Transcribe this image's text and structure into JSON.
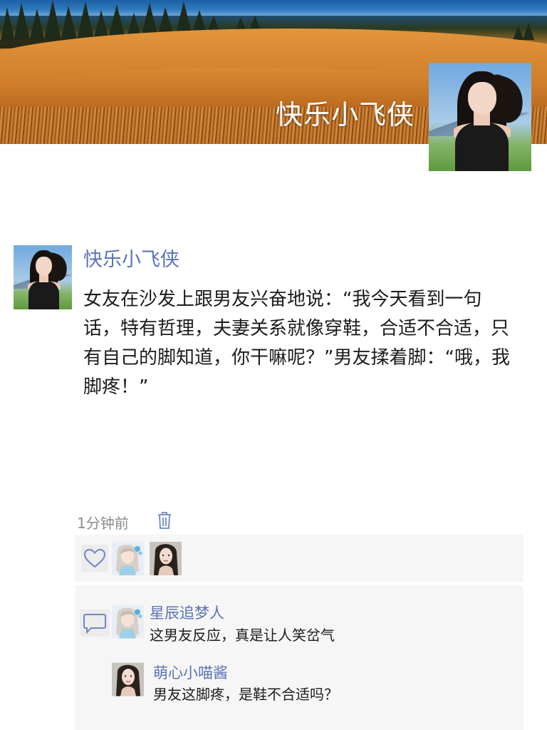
{
  "header": {
    "title": "快乐小飞侠",
    "banner_image": "golden-wheat-field-landscape",
    "avatar_image": "woman-portrait-outdoors"
  },
  "post": {
    "author": "快乐小飞侠",
    "avatar_image": "woman-portrait-outdoors",
    "text": "女友在沙发上跟男友兴奋地说：“我今天看到一句话，特有哲理，夫妻关系就像穿鞋，合适不合适，只有自己的脚知道，你干嘛呢？”男友揉着脚：“哦，我脚疼！”",
    "time": "1分钟前",
    "delete_icon": "trash-icon"
  },
  "likes": {
    "icon": "heart-icon",
    "users": [
      {
        "avatar": "anime-girl-avatar"
      },
      {
        "avatar": "woman-portrait-avatar"
      }
    ]
  },
  "comments": {
    "icon": "comment-bubble-icon",
    "items": [
      {
        "name": "星辰追梦人",
        "text": "这男友反应，真是让人笑岔气",
        "avatar": "anime-girl-avatar"
      },
      {
        "name": "萌心小喵酱",
        "text": "男友这脚疼，是鞋不合适吗？",
        "avatar": "woman-portrait-avatar"
      }
    ]
  },
  "colors": {
    "name_link": "#5a73b8",
    "body_text": "#1c1c1c",
    "meta_text": "#8b8b8b",
    "panel_bg": "#f6f6f6"
  }
}
